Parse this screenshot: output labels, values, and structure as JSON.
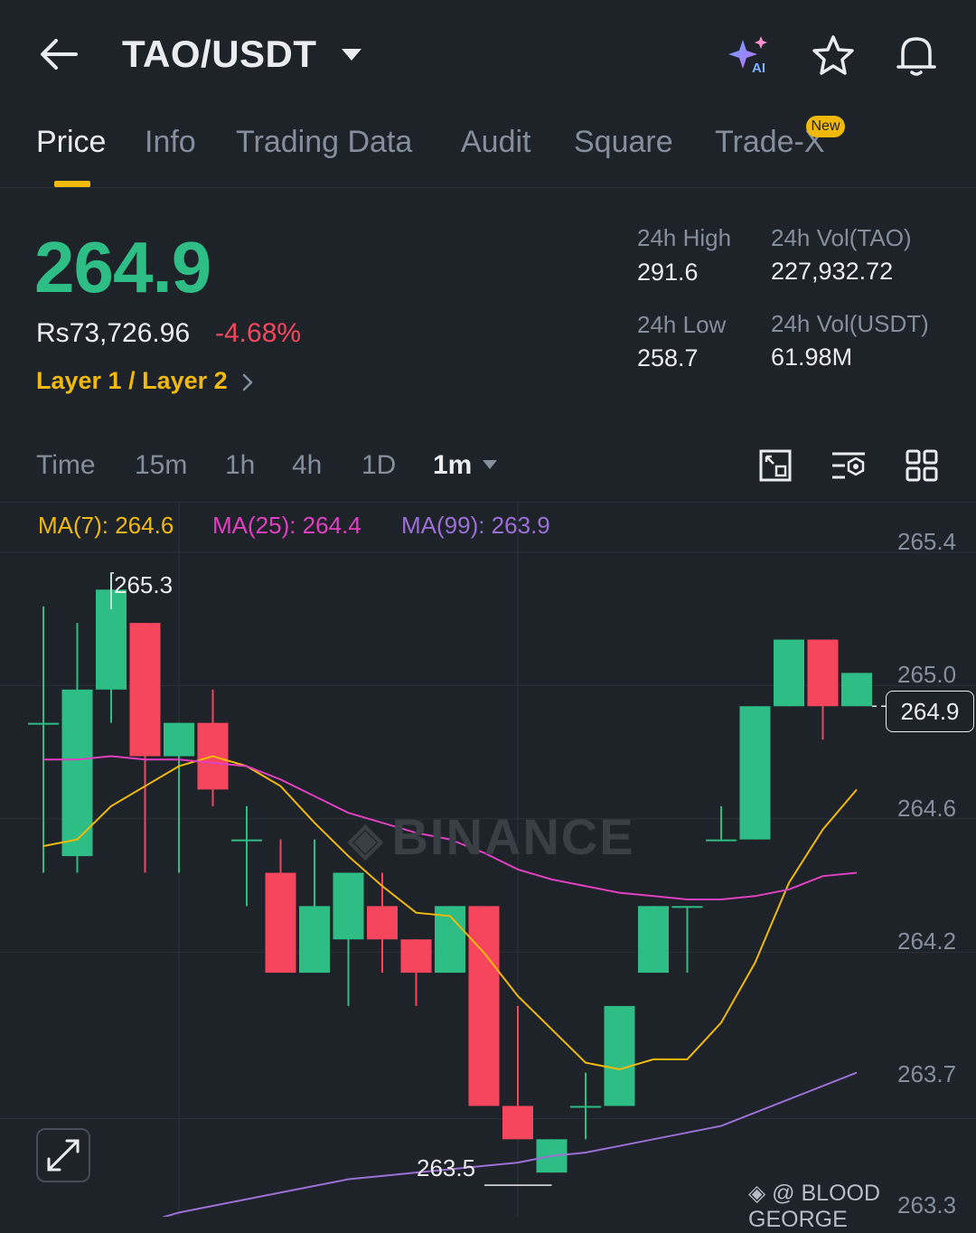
{
  "header": {
    "title": "TAO/USDT"
  },
  "tabs": [
    {
      "label": "Price",
      "active": true
    },
    {
      "label": "Info"
    },
    {
      "label": "Trading Data"
    },
    {
      "label": "Audit"
    },
    {
      "label": "Square"
    },
    {
      "label": "Trade-X",
      "badge": "New"
    }
  ],
  "ticker": {
    "last_price": "264.9",
    "fiat_price": "Rs73,726.96",
    "change_pct": "-4.68%",
    "sector": "Layer 1 / Layer 2"
  },
  "stats": {
    "high_label": "24h High",
    "high_value": "291.6",
    "low_label": "24h Low",
    "low_value": "258.7",
    "vol_base_label": "24h Vol(TAO)",
    "vol_base_value": "227,932.72",
    "vol_quote_label": "24h Vol(USDT)",
    "vol_quote_value": "61.98M"
  },
  "timeframes": [
    "Time",
    "15m",
    "1h",
    "4h",
    "1D"
  ],
  "selected_interval": "1m",
  "ma_legend": {
    "ma7": "MA(7): 264.6",
    "ma25": "MA(25): 264.4",
    "ma99": "MA(99): 263.9"
  },
  "colors": {
    "up": "#2ebd85",
    "down": "#f6465d",
    "accent": "#f0b90b",
    "ma7": "#f0b90b",
    "ma25": "#e040c0",
    "ma99": "#9b6fd6"
  },
  "icons": [
    "back-arrow-icon",
    "caret-down-icon",
    "ai-sparkle-icon",
    "star-icon",
    "bell-icon",
    "chart-fullscreen-icon",
    "indicator-settings-icon",
    "grid-layout-icon",
    "expand-icon",
    "chevron-right-icon"
  ],
  "watermark": "BINANCE",
  "credit": "@ BLOOD GEORGE",
  "chart_data": {
    "type": "candlestick",
    "interval": "1m",
    "y_ticks": [
      "265.4",
      "265.0",
      "264.6",
      "264.2",
      "263.7",
      "263.3"
    ],
    "ylim": [
      263.3,
      265.4
    ],
    "current_price": "264.9",
    "high_marker": "265.3",
    "low_marker": "263.5",
    "candles": [
      {
        "o": 264.85,
        "h": 265.2,
        "l": 264.4,
        "c": 264.85
      },
      {
        "o": 264.45,
        "h": 265.15,
        "l": 264.4,
        "c": 264.95
      },
      {
        "o": 264.95,
        "h": 265.3,
        "l": 264.85,
        "c": 265.25
      },
      {
        "o": 265.15,
        "h": 265.15,
        "l": 264.4,
        "c": 264.75
      },
      {
        "o": 264.75,
        "h": 264.85,
        "l": 264.4,
        "c": 264.85
      },
      {
        "o": 264.85,
        "h": 264.95,
        "l": 264.6,
        "c": 264.65
      },
      {
        "o": 264.5,
        "h": 264.6,
        "l": 264.3,
        "c": 264.5
      },
      {
        "o": 264.4,
        "h": 264.5,
        "l": 264.1,
        "c": 264.1
      },
      {
        "o": 264.1,
        "h": 264.5,
        "l": 264.1,
        "c": 264.3
      },
      {
        "o": 264.2,
        "h": 264.4,
        "l": 264.0,
        "c": 264.4
      },
      {
        "o": 264.3,
        "h": 264.4,
        "l": 264.1,
        "c": 264.2
      },
      {
        "o": 264.2,
        "h": 264.2,
        "l": 264.0,
        "c": 264.1
      },
      {
        "o": 264.1,
        "h": 264.3,
        "l": 264.1,
        "c": 264.3
      },
      {
        "o": 264.3,
        "h": 264.3,
        "l": 263.7,
        "c": 263.7
      },
      {
        "o": 263.7,
        "h": 264.0,
        "l": 263.6,
        "c": 263.6
      },
      {
        "o": 263.5,
        "h": 263.6,
        "l": 263.5,
        "c": 263.6
      },
      {
        "o": 263.7,
        "h": 263.8,
        "l": 263.6,
        "c": 263.7
      },
      {
        "o": 263.7,
        "h": 264.0,
        "l": 263.7,
        "c": 264.0
      },
      {
        "o": 264.1,
        "h": 264.3,
        "l": 264.1,
        "c": 264.3
      },
      {
        "o": 264.3,
        "h": 264.3,
        "l": 264.1,
        "c": 264.3
      },
      {
        "o": 264.5,
        "h": 264.6,
        "l": 264.5,
        "c": 264.5
      },
      {
        "o": 264.5,
        "h": 264.9,
        "l": 264.5,
        "c": 264.9
      },
      {
        "o": 264.9,
        "h": 265.0,
        "l": 264.9,
        "c": 265.1
      },
      {
        "o": 265.1,
        "h": 265.1,
        "l": 264.8,
        "c": 264.9
      },
      {
        "o": 264.9,
        "h": 265.0,
        "l": 264.9,
        "c": 265.0
      }
    ],
    "series": [
      {
        "name": "MA(7)",
        "values": [
          264.48,
          264.5,
          264.6,
          264.66,
          264.72,
          264.75,
          264.72,
          264.66,
          264.55,
          264.45,
          264.36,
          264.28,
          264.27,
          264.16,
          264.03,
          263.93,
          263.83,
          263.81,
          263.84,
          263.84,
          263.95,
          264.13,
          264.37,
          264.53,
          264.65
        ]
      },
      {
        "name": "MA(25)",
        "values": [
          264.74,
          264.74,
          264.75,
          264.74,
          264.74,
          264.73,
          264.72,
          264.68,
          264.63,
          264.58,
          264.55,
          264.52,
          264.5,
          264.46,
          264.41,
          264.38,
          264.36,
          264.34,
          264.33,
          264.32,
          264.32,
          264.33,
          264.35,
          264.39,
          264.4
        ]
      },
      {
        "name": "MA(99)",
        "values": [
          263.26,
          263.29,
          263.32,
          263.35,
          263.38,
          263.4,
          263.42,
          263.44,
          263.46,
          263.48,
          263.49,
          263.5,
          263.51,
          263.52,
          263.53,
          263.55,
          263.56,
          263.58,
          263.6,
          263.62,
          263.64,
          263.68,
          263.72,
          263.76,
          263.8
        ]
      }
    ]
  }
}
